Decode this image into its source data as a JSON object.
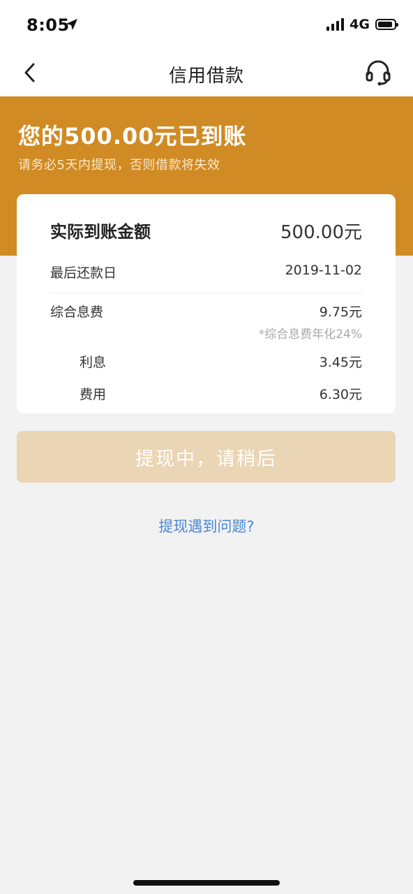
{
  "status_bar": {
    "time": "8:05",
    "network": "4G",
    "location_icon": "location-arrow-icon",
    "signal_icon": "signal-bars-icon",
    "battery_icon": "battery-icon"
  },
  "nav": {
    "title": "信用借款",
    "back_icon": "chevron-left-icon",
    "support_icon": "headset-icon"
  },
  "banner": {
    "title": "您的500.00元已到账",
    "subtitle": "请务必5天内提现，否则借款将失效",
    "color": "#d08b24"
  },
  "details": {
    "actual_amount_label": "实际到账金额",
    "actual_amount_value": "500.00元",
    "repay_date_label": "最后还款日",
    "repay_date_value": "2019-11-02",
    "fee_label": "综合息费",
    "fee_value": "9.75元",
    "fee_note": "*综合息费年化24%",
    "interest_label": "利息",
    "interest_value": "3.45元",
    "cost_label": "费用",
    "cost_value": "6.30元"
  },
  "actions": {
    "withdraw_label": "提现中，请稍后",
    "help_link": "提现遇到问题?",
    "button_color": "#ead5b4",
    "link_color": "#4a86d6"
  }
}
